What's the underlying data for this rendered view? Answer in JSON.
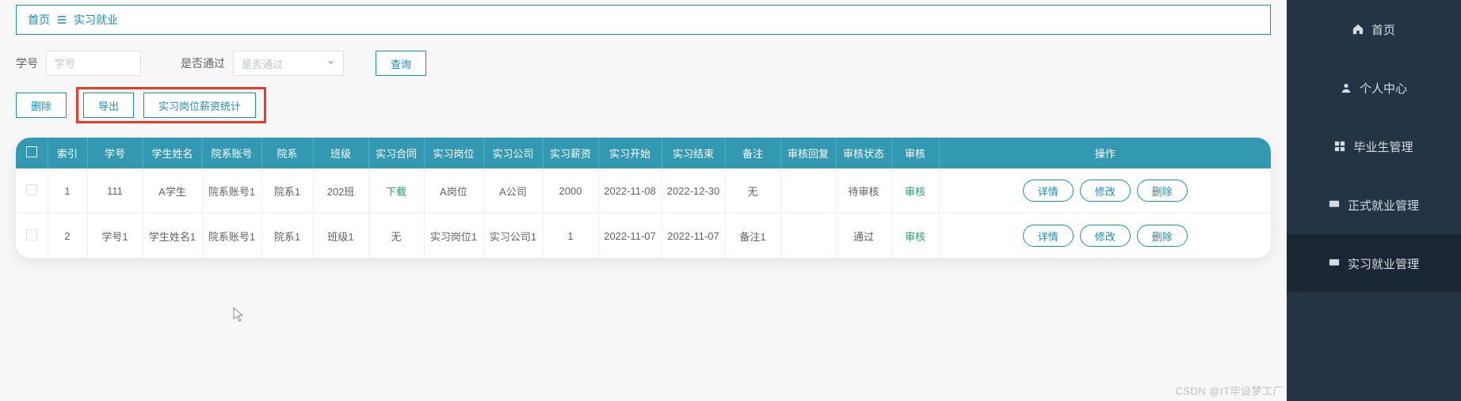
{
  "breadcrumb": {
    "home": "首页",
    "current": "实习就业"
  },
  "filters": {
    "id_label": "学号",
    "id_placeholder": "学号",
    "pass_label": "是否通过",
    "pass_placeholder": "是否通过",
    "search_btn": "查询"
  },
  "bulk": {
    "delete_btn": "删除",
    "export_btn": "导出",
    "salary_stat_btn": "实习岗位薪资统计"
  },
  "table": {
    "headers": {
      "index": "索引",
      "sid": "学号",
      "sname": "学生姓名",
      "dept_acc": "院系账号",
      "dept": "院系",
      "class": "班级",
      "contract": "实习合同",
      "post": "实习岗位",
      "company": "实习公司",
      "salary": "实习薪资",
      "start": "实习开始",
      "end": "实习结束",
      "remark": "备注",
      "reply": "审核回复",
      "status": "审核状态",
      "audit": "审核",
      "op": "操作"
    },
    "actions": {
      "audit": "审核",
      "detail": "详情",
      "edit": "修改",
      "delete": "删除"
    },
    "rows": [
      {
        "index": "1",
        "sid": "111",
        "sname": "A学生",
        "dept_acc": "院系账号1",
        "dept": "院系1",
        "class": "202班",
        "contract": "下载",
        "post": "A岗位",
        "company": "A公司",
        "salary": "2000",
        "start": "2022-11-08",
        "end": "2022-12-30",
        "remark": "无",
        "reply": "",
        "status": "待审核"
      },
      {
        "index": "2",
        "sid": "学号1",
        "sname": "学生姓名1",
        "dept_acc": "院系账号1",
        "dept": "院系1",
        "class": "班级1",
        "contract": "无",
        "post": "实习岗位1",
        "company": "实习公司1",
        "salary": "1",
        "start": "2022-11-07",
        "end": "2022-11-07",
        "remark": "备注1",
        "reply": "",
        "status": "通过"
      }
    ]
  },
  "sidebar": {
    "items": [
      {
        "label": "首页",
        "icon": "home-icon"
      },
      {
        "label": "个人中心",
        "icon": "user-icon"
      },
      {
        "label": "毕业生管理",
        "icon": "grid-icon"
      },
      {
        "label": "正式就业管理",
        "icon": "monitor-icon"
      },
      {
        "label": "实习就业管理",
        "icon": "monitor-icon"
      }
    ]
  },
  "watermark": "CSDN @IT毕设梦工厂"
}
